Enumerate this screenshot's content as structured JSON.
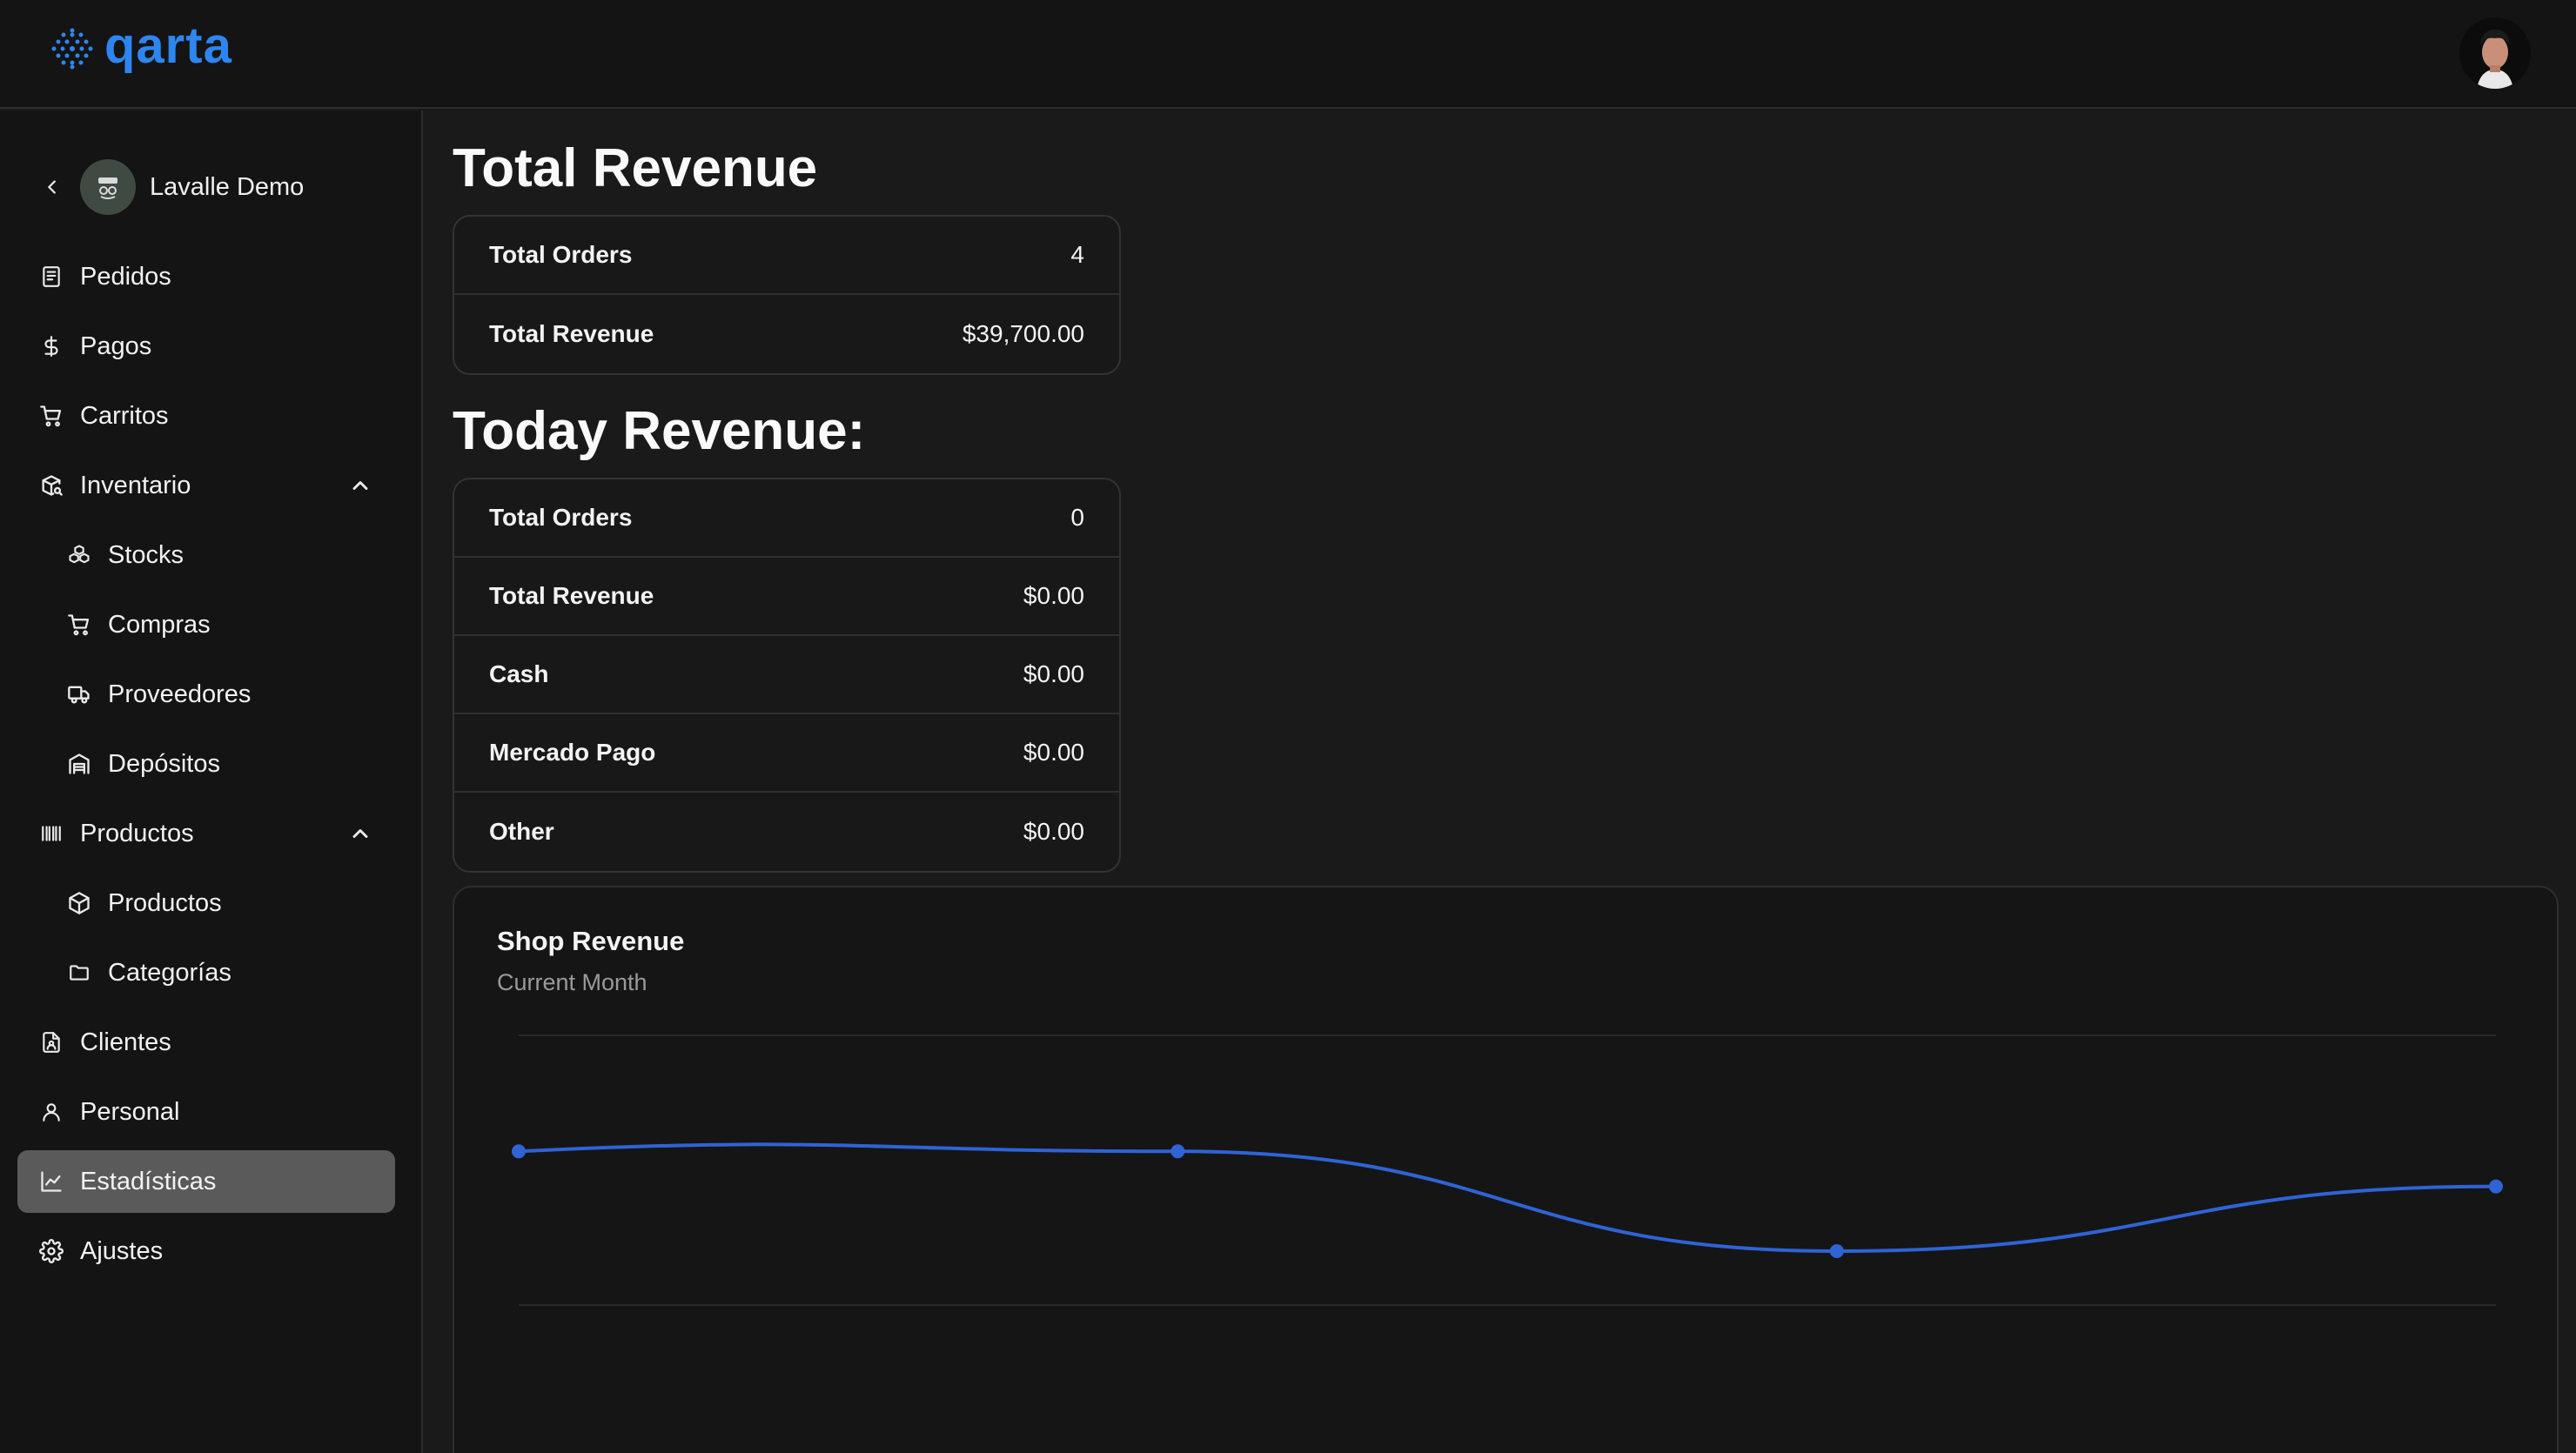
{
  "app": {
    "name": "qarta",
    "accent": "#2d86f0"
  },
  "sidebar": {
    "store_name": "Lavalle Demo",
    "items": [
      {
        "label": "Pedidos",
        "icon": "receipt-icon"
      },
      {
        "label": "Pagos",
        "icon": "dollar-icon"
      },
      {
        "label": "Carritos",
        "icon": "cart-icon"
      },
      {
        "label": "Inventario",
        "icon": "package-search-icon",
        "expanded": true
      },
      {
        "label": "Stocks",
        "icon": "boxes-icon"
      },
      {
        "label": "Compras",
        "icon": "cart-icon"
      },
      {
        "label": "Proveedores",
        "icon": "truck-icon"
      },
      {
        "label": "Depósitos",
        "icon": "warehouse-icon"
      },
      {
        "label": "Productos",
        "icon": "barcode-icon",
        "expanded": true
      },
      {
        "label": "Productos",
        "icon": "box-icon"
      },
      {
        "label": "Categorías",
        "icon": "folder-icon"
      },
      {
        "label": "Clientes",
        "icon": "contact-file-icon"
      },
      {
        "label": "Personal",
        "icon": "user-icon"
      },
      {
        "label": "Estadísticas",
        "icon": "line-chart-icon",
        "active": true
      },
      {
        "label": "Ajustes",
        "icon": "gear-icon"
      }
    ]
  },
  "total_revenue": {
    "title": "Total Revenue",
    "rows": [
      {
        "label": "Total Orders",
        "value": "4"
      },
      {
        "label": "Total Revenue",
        "value": "$39,700.00"
      }
    ]
  },
  "today_revenue": {
    "title": "Today Revenue:",
    "rows": [
      {
        "label": "Total Orders",
        "value": "0"
      },
      {
        "label": "Total Revenue",
        "value": "$0.00"
      },
      {
        "label": "Cash",
        "value": "$0.00"
      },
      {
        "label": "Mercado Pago",
        "value": "$0.00"
      },
      {
        "label": "Other",
        "value": "$0.00"
      }
    ]
  },
  "shop_revenue": {
    "title": "Shop Revenue",
    "subtitle": "Current Month",
    "line_color": "#2f63d6"
  },
  "chart_data": {
    "type": "line",
    "title": "Shop Revenue",
    "subtitle": "Current Month",
    "xlabel": "",
    "ylabel": "",
    "grid": true,
    "ylim": [
      0,
      1
    ],
    "series": [
      {
        "values": [
          0.57,
          0.57,
          0.2,
          0.44
        ]
      }
    ]
  }
}
